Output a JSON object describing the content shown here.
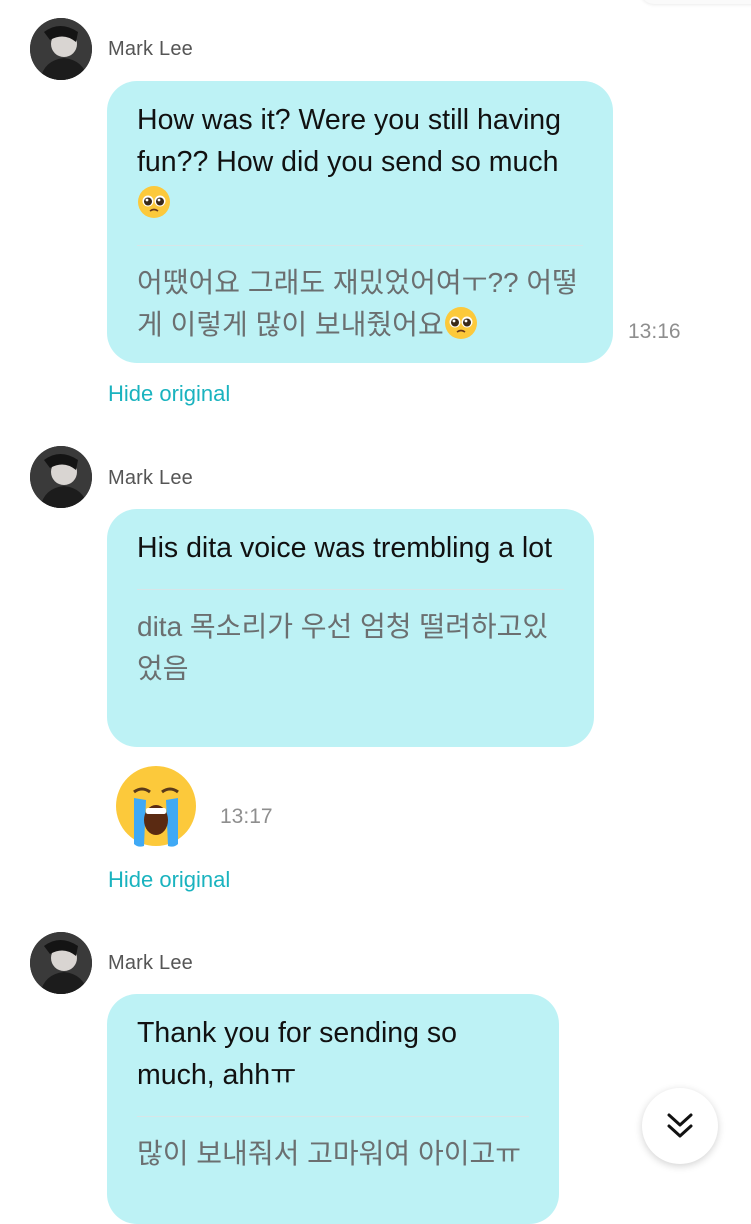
{
  "messages": [
    {
      "sender": "Mark Lee",
      "english": "How was it? Were you still having fun?? How did you send so much",
      "korean": "어땠어요 그래도 재밌었어여ㅜ?? 어떻게 이렇게 많이 보내줬어요",
      "time": "13:16",
      "toggle": "Hide original"
    },
    {
      "sender": "Mark Lee",
      "english": "His dita voice was trembling a lot",
      "korean": "dita 목소리가 우선 엄청 떨려하고있었음",
      "time": "13:17",
      "toggle": "Hide original"
    },
    {
      "sender": "Mark Lee",
      "english": "Thank you for sending so much, ahhㅠ",
      "korean": "많이 보내줘서 고마워여 아이고ㅠ"
    }
  ],
  "icons": {
    "pleading": "pleading-face-emoji",
    "crying": "loudly-crying-face-emoji",
    "scroll": "double-chevron-down-icon"
  },
  "colors": {
    "bubble": "#bdf2f5",
    "link": "#1ab3bf"
  }
}
